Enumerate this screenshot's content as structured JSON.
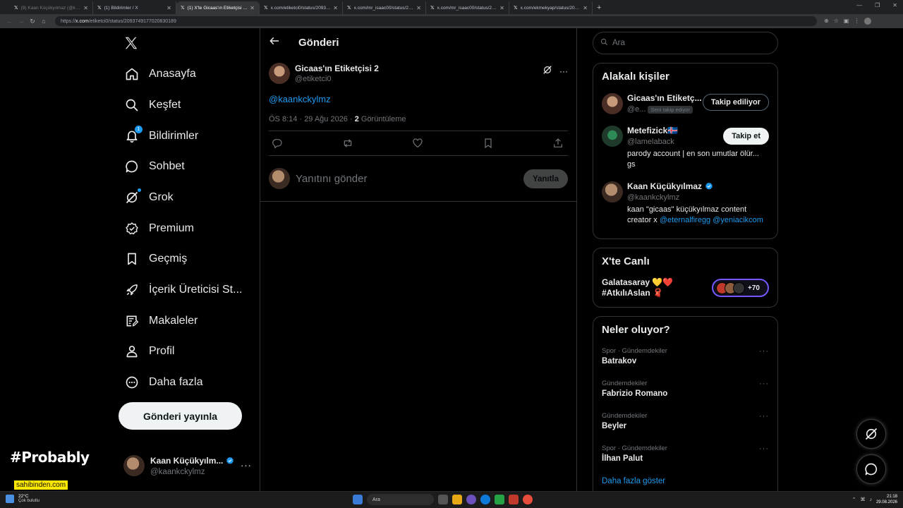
{
  "browser": {
    "tabs": [
      {
        "title": "(9) Kaan Küçükyılmaz (@kaankckylmz)",
        "favicon": "X",
        "state": "dim"
      },
      {
        "title": "(1) Bildirimler / X",
        "favicon": "X",
        "state": "normal"
      },
      {
        "title": "(1) X'te Gicaas'ın Etiketçisi 2: \"@kaankckylmz\"",
        "favicon": "X",
        "state": "active"
      },
      {
        "title": "x.com/etiketci0/status/2093749617702083018",
        "favicon": "X",
        "state": "normal"
      },
      {
        "title": "x.com/mr_isaac00/status/20937526",
        "favicon": "X",
        "state": "normal"
      },
      {
        "title": "x.com/mr_isaac00/status/20937526",
        "favicon": "X",
        "state": "normal"
      },
      {
        "title": "x.com/ekmekyap/status/20937566",
        "favicon": "X",
        "state": "normal"
      }
    ],
    "url_prefix": "https://",
    "url_domain": "x.com",
    "url_path": "/etiketci0/status/2093749177020830189"
  },
  "nav": {
    "logo": "X",
    "items": [
      {
        "label": "Anasayfa",
        "icon": "home-icon"
      },
      {
        "label": "Keşfet",
        "icon": "search-icon"
      },
      {
        "label": "Bildirimler",
        "icon": "bell-icon",
        "badge": "1"
      },
      {
        "label": "Sohbet",
        "icon": "chat-icon"
      },
      {
        "label": "Grok",
        "icon": "grok-icon"
      },
      {
        "label": "Premium",
        "icon": "premium-icon"
      },
      {
        "label": "Geçmiş",
        "icon": "bookmark-icon"
      },
      {
        "label": "İçerik Üreticisi St...",
        "icon": "rocket-icon"
      },
      {
        "label": "Makaleler",
        "icon": "article-icon"
      },
      {
        "label": "Profil",
        "icon": "person-icon"
      },
      {
        "label": "Daha fazla",
        "icon": "more-circle-icon"
      }
    ],
    "post_button": "Gönderi yayınla",
    "account": {
      "name": "Kaan Küçükyılm...",
      "handle": "@kaankckylmz"
    }
  },
  "header": {
    "title": "Gönderi"
  },
  "tweet": {
    "author": "Gicaas'ın Etiketçisi 2",
    "handle": "@etiketci0",
    "text": "@kaankckylmz",
    "time": "ÖS 8:14 · 29 Ağu 2026 · ",
    "views_count": "2",
    "views_label": " Görüntüleme"
  },
  "reply": {
    "placeholder": "Yanıtını gönder",
    "button": "Yanıtla"
  },
  "search": {
    "placeholder": "Ara"
  },
  "related": {
    "title": "Alakalı kişiler",
    "people": [
      {
        "name": "Gicaas'ın Etiketç...",
        "handle": "@e...",
        "follows_you": "Seni takip ediyor",
        "button": "Takip ediliyor",
        "bio": ""
      },
      {
        "name": "Metefizick🇮🇸",
        "handle": "@lamelaback",
        "button": "Takip et",
        "bio": "parody account | en son umutlar ölür... gs"
      },
      {
        "name": "Kaan Küçükyılmaz",
        "handle": "@kaankckylmz",
        "bio": "kaan \"gicaas\" küçükyılmaz content creator x ",
        "bio_link1": "@eternalfiregg",
        "bio_link2": "@yeniacikcom"
      }
    ]
  },
  "live": {
    "title": "X'te Canlı",
    "line1": "Galatasaray 💛❤️",
    "line2": "#AtkılıAslan 🧣",
    "count": "+70"
  },
  "trends": {
    "title": "Neler oluyor?",
    "items": [
      {
        "context": "Spor · Gündemdekiler",
        "name": "Batrakov"
      },
      {
        "context": "Gündemdekiler",
        "name": "Fabrizio Romano"
      },
      {
        "context": "Gündemdekiler",
        "name": "Beyler"
      },
      {
        "context": "Spor · Gündemdekiler",
        "name": "İlhan Palut"
      }
    ],
    "show_more": "Daha fazla göster"
  },
  "overlay": {
    "watermark": "#Probably",
    "sponsor": "sahibinden.com"
  },
  "taskbar": {
    "temp": "22°C",
    "weather": "Çok bulutlu",
    "search": "Ara",
    "time": "21:18",
    "date": "29.08.2026"
  },
  "colors": {
    "accent": "#1d9bf0",
    "background": "#000000",
    "border": "#2f3336",
    "live_ring": "#7856ff"
  }
}
